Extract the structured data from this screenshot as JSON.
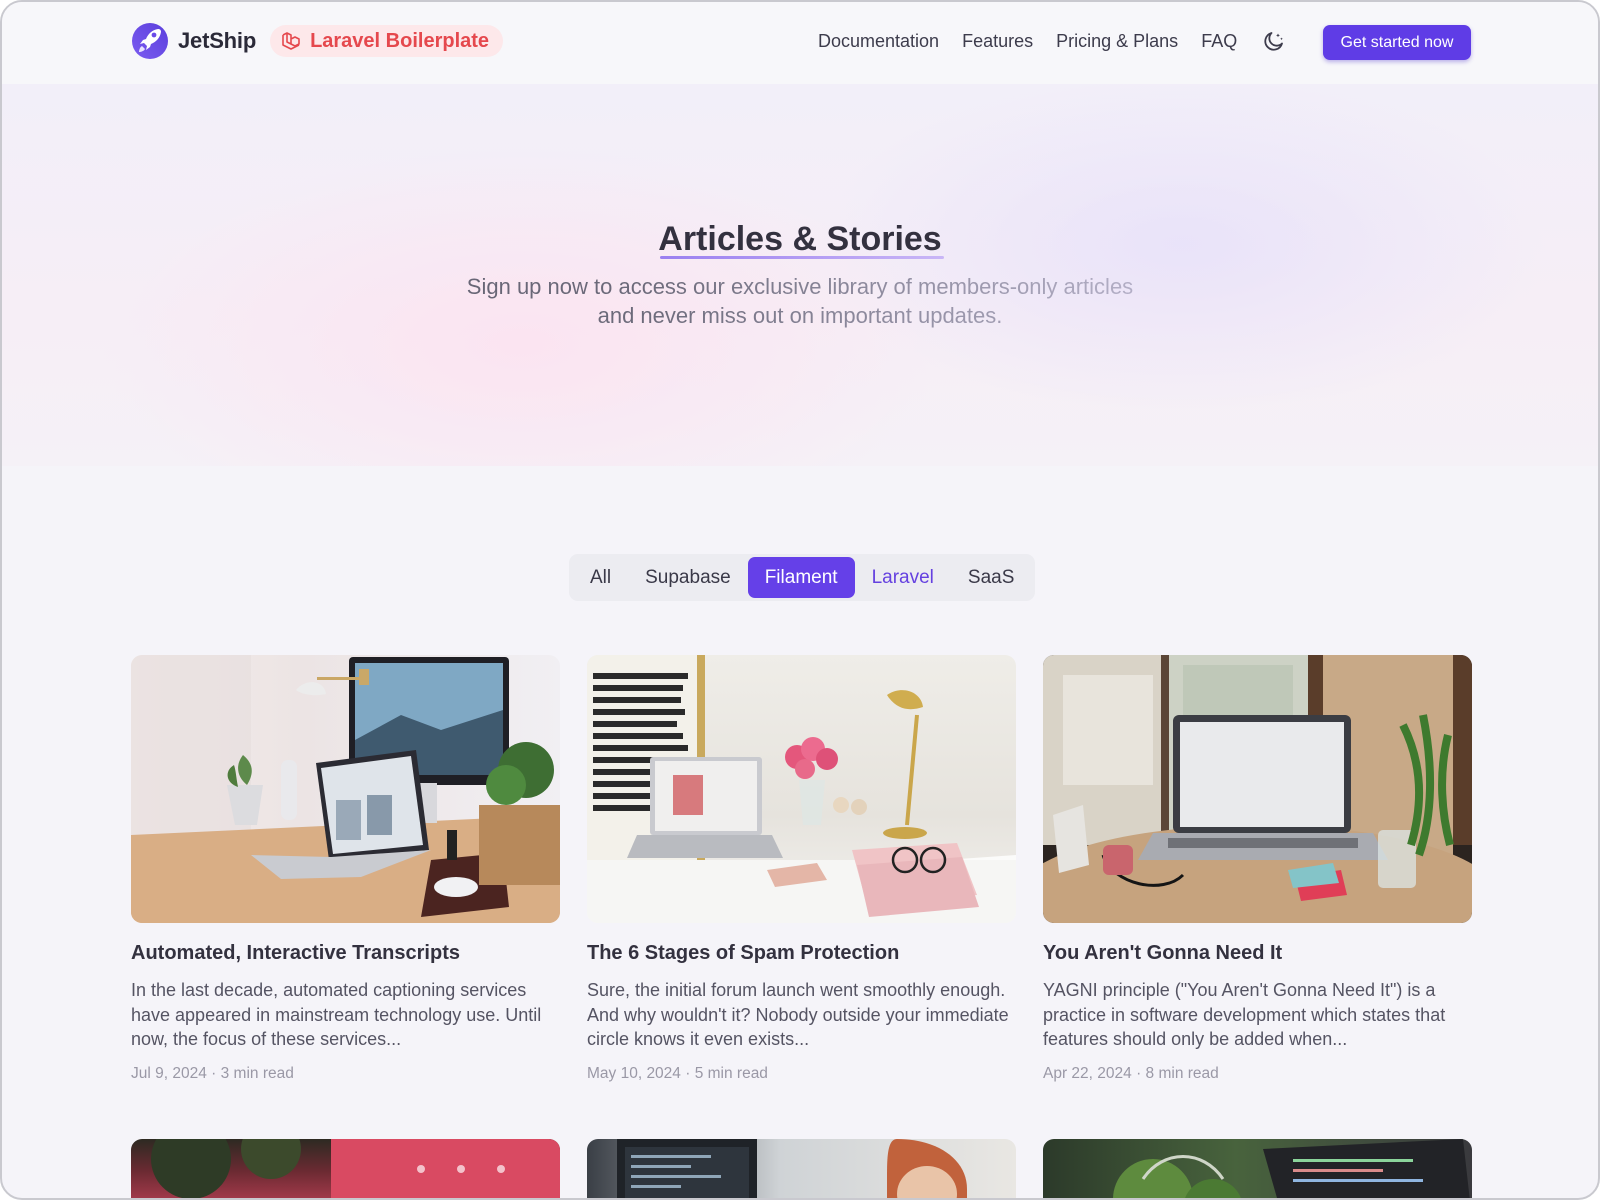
{
  "header": {
    "brand": "JetShip",
    "badge": "Laravel Boilerplate",
    "nav": [
      "Documentation",
      "Features",
      "Pricing & Plans",
      "FAQ"
    ],
    "cta": "Get started now"
  },
  "hero": {
    "title": "Articles & Stories",
    "subtitle_line1": "Sign up now to access our exclusive library of members-only articles",
    "subtitle_line2": "and never miss out on important updates."
  },
  "filters": {
    "all": "All",
    "supabase": "Supabase",
    "filament": "Filament",
    "laravel": "Laravel",
    "saas": "SaaS",
    "selected": "Filament"
  },
  "articles": [
    {
      "title": "Automated, Interactive Transcripts",
      "excerpt": "In the last decade, automated captioning services have appeared in mainstream technology use. Until now, the focus of these services...",
      "meta": "Jul 9, 2024 · 3 min read",
      "image": "desk-with-laptop-and-imac-photo"
    },
    {
      "title": "The 6 Stages of Spam Protection",
      "excerpt": "Sure, the initial forum launch went smoothly enough. And why wouldn't it? Nobody outside your immediate circle knows it even exists...",
      "meta": "May 10, 2024 · 5 min read",
      "image": "desk-with-laptop-flowers-and-lamp-photo"
    },
    {
      "title": "You Aren't Gonna Need It",
      "excerpt": "YAGNI principle (\"You Aren't Gonna Need It\") is a practice in software development which states that features should only be added when...",
      "meta": "Apr 22, 2024 · 8 min read",
      "image": "laptop-on-round-table-photo"
    }
  ],
  "colors": {
    "accent": "#6540e8",
    "laravel_red": "#e5484d"
  }
}
